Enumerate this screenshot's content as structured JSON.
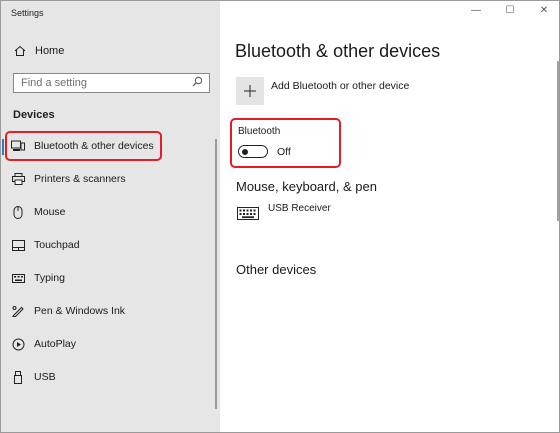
{
  "window": {
    "title": "Settings",
    "controls": {
      "minimize": "—",
      "maximize": "☐",
      "close": "✕"
    }
  },
  "sidebar": {
    "home_label": "Home",
    "search": {
      "placeholder": "Find a setting"
    },
    "section_title": "Devices",
    "items": [
      {
        "label": "Bluetooth & other devices",
        "icon": "bluetooth-devices-icon",
        "selected": true
      },
      {
        "label": "Printers & scanners",
        "icon": "printer-icon"
      },
      {
        "label": "Mouse",
        "icon": "mouse-icon"
      },
      {
        "label": "Touchpad",
        "icon": "touchpad-icon"
      },
      {
        "label": "Typing",
        "icon": "keyboard-icon"
      },
      {
        "label": "Pen & Windows Ink",
        "icon": "pen-icon"
      },
      {
        "label": "AutoPlay",
        "icon": "autoplay-icon"
      },
      {
        "label": "USB",
        "icon": "usb-icon"
      }
    ]
  },
  "main": {
    "title": "Bluetooth & other devices",
    "add_device_label": "Add Bluetooth or other device",
    "bluetooth": {
      "label": "Bluetooth",
      "state": "Off",
      "on": false
    },
    "mouse_keyboard_pen": {
      "heading": "Mouse, keyboard, & pen",
      "devices": [
        {
          "name": "USB Receiver",
          "icon": "keyboard-icon"
        }
      ]
    },
    "other_devices": {
      "heading": "Other devices"
    }
  },
  "colors": {
    "sidebar_bg": "#e6e6e6",
    "highlight_red": "#e31e24",
    "accent_blue": "#3a78c3"
  }
}
